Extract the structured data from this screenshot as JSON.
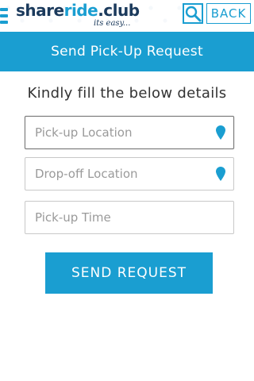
{
  "header": {
    "logo": {
      "part1": "share",
      "part2": "ride",
      "part3": ".club",
      "tagline": "its easy..."
    },
    "back_label": "BACK",
    "icons": {
      "menu": "menu-icon",
      "search": "search-icon"
    }
  },
  "banner": {
    "title": "Send Pick-Up Request"
  },
  "form": {
    "instruction": "Kindly fill the below details",
    "fields": [
      {
        "placeholder": "Pick-up Location",
        "icon": "map-pin-icon"
      },
      {
        "placeholder": "Drop-off Location",
        "icon": "map-pin-icon"
      },
      {
        "placeholder": "Pick-up Time"
      }
    ],
    "submit_label": "SEND REQUEST"
  },
  "colors": {
    "accent": "#1a9ed1",
    "brand_dark": "#1b3a5c",
    "placeholder": "#9a9a9a"
  }
}
